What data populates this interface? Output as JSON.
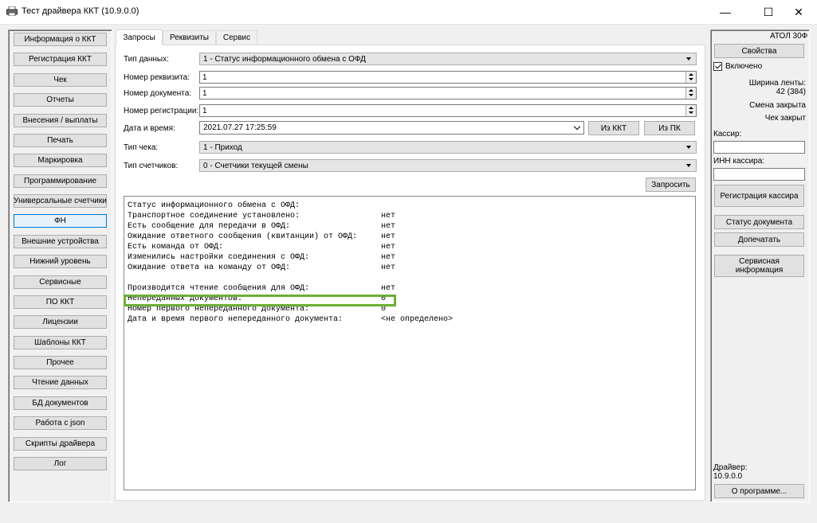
{
  "window": {
    "title": "Тест драйвера ККТ (10.9.0.0)",
    "minimize_glyph": "—",
    "maximize_glyph": "☐",
    "close_glyph": "✕"
  },
  "sidebar": {
    "items": [
      {
        "label": "Информация о ККТ",
        "active": false
      },
      {
        "label": "Регистрация ККТ",
        "active": false
      },
      {
        "label": "Чек",
        "active": false
      },
      {
        "label": "Отчеты",
        "active": false
      },
      {
        "label": "Внесения / выплаты",
        "active": false
      },
      {
        "label": "Печать",
        "active": false
      },
      {
        "label": "Маркировка",
        "active": false
      },
      {
        "label": "Программирование",
        "active": false
      },
      {
        "label": "Универсальные счетчики",
        "active": false
      },
      {
        "label": "ФН",
        "active": true
      },
      {
        "label": "Внешние устройства",
        "active": false
      },
      {
        "label": "Нижний уровень",
        "active": false
      },
      {
        "label": "Сервисные",
        "active": false
      },
      {
        "label": "ПО ККТ",
        "active": false
      },
      {
        "label": "Лицензии",
        "active": false
      },
      {
        "label": "Шаблоны ККТ",
        "active": false
      },
      {
        "label": "Прочее",
        "active": false
      },
      {
        "label": "Чтение данных",
        "active": false
      },
      {
        "label": "БД документов",
        "active": false
      },
      {
        "label": "Работа с json",
        "active": false
      },
      {
        "label": "Скрипты драйвера",
        "active": false
      },
      {
        "label": "Лог",
        "active": false
      }
    ]
  },
  "tabs": [
    {
      "label": "Запросы",
      "active": true
    },
    {
      "label": "Реквизиты",
      "active": false
    },
    {
      "label": "Сервис",
      "active": false
    }
  ],
  "form": {
    "data_type_label": "Тип данных:",
    "data_type_value": "1 - Статус информационного обмена с ОФД",
    "requisite_number_label": "Номер реквизита:",
    "requisite_number_value": "1",
    "document_number_label": "Номер документа:",
    "document_number_value": "1",
    "registration_number_label": "Номер регистрации:",
    "registration_number_value": "1",
    "datetime_label": "Дата и время:",
    "datetime_value": "2021.07.27 17:25:59",
    "from_kkt_button": "Из ККТ",
    "from_pc_button": "Из ПК",
    "receipt_type_label": "Тип чека:",
    "receipt_type_value": "1 - Приход",
    "counters_type_label": "Тип счетчиков:",
    "counters_type_value": "0 - Счетчики текущей смены",
    "query_button": "Запросить"
  },
  "output": {
    "lines": [
      {
        "text": "Статус информационного обмена с ОФД:",
        "value": ""
      },
      {
        "text": "Транспортное соединение установлено:",
        "value": "нет"
      },
      {
        "text": "Есть сообщение для передачи в ОФД:",
        "value": "нет"
      },
      {
        "text": "Ожидание ответного сообщения (квитанции) от ОФД:",
        "value": "нет"
      },
      {
        "text": "Есть команда от ОФД:",
        "value": "нет"
      },
      {
        "text": "Изменились настройки соединения с ОФД:",
        "value": "нет"
      },
      {
        "text": "Ожидание ответа на команду от ОФД:",
        "value": "нет"
      },
      {
        "text": "",
        "value": ""
      },
      {
        "text": "Производится чтение сообщения для ОФД:",
        "value": "нет"
      },
      {
        "text": "Непереданных документов:",
        "value": "0"
      },
      {
        "text": "Номер первого непереданного документа:",
        "value": "0"
      },
      {
        "text": "Дата и время первого непереданного документа:",
        "value": "<не определено>"
      }
    ],
    "highlight_color": "#6aaf35"
  },
  "right_panel": {
    "model": "АТОЛ 30Ф",
    "properties_button": "Свойства",
    "enabled_label": "Включено",
    "enabled_checked": true,
    "tape_width_label": "Ширина ленты:",
    "tape_width_value": "42 (384)",
    "shift_status": "Смена закрыта",
    "receipt_status": "Чек закрыт",
    "cashier_label": "Кассир:",
    "cashier_value": "",
    "cashier_inn_label": "ИНН кассира:",
    "cashier_inn_value": "",
    "register_cashier_button": "Регистрация кассира",
    "document_status_button": "Статус документа",
    "reprint_button": "Допечатать",
    "service_info_button": "Сервисная информация",
    "driver_label": "Драйвер:",
    "driver_version": "10.9.0.0",
    "about_button": "О программе..."
  },
  "colors": {
    "active_nav_border": "#0078d7",
    "active_nav_bg": "#e5f1fb"
  }
}
